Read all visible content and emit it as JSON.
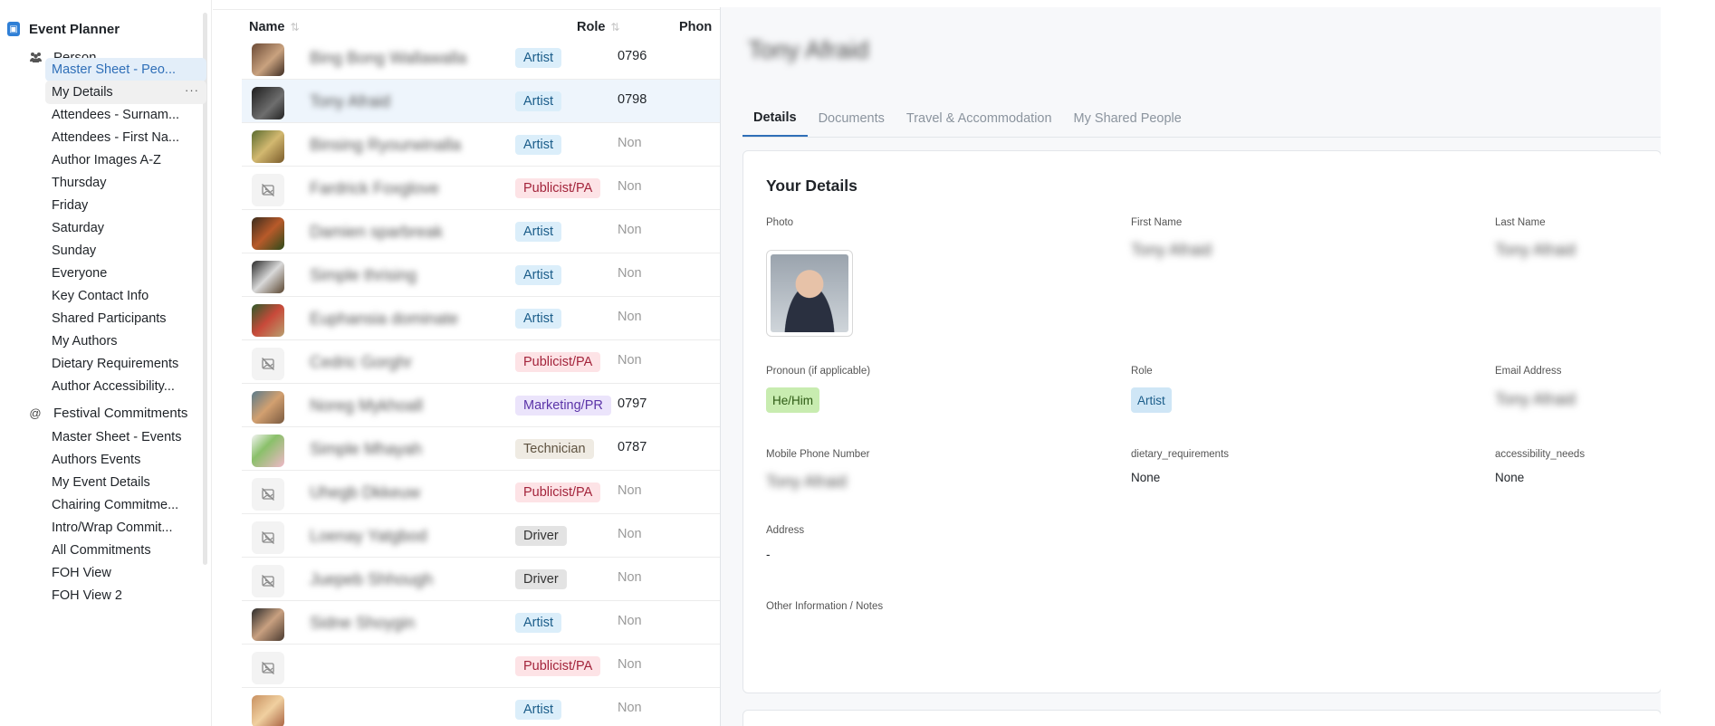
{
  "sidebar": {
    "app_title": "Event Planner",
    "sections": [
      {
        "label": "Person",
        "items": [
          {
            "label": "Master Sheet - Peo..."
          },
          {
            "label": "My Details"
          },
          {
            "label": "Attendees - Surnam..."
          },
          {
            "label": "Attendees - First Na..."
          },
          {
            "label": "Author Images A-Z"
          },
          {
            "label": "Thursday"
          },
          {
            "label": "Friday"
          },
          {
            "label": "Saturday"
          },
          {
            "label": "Sunday"
          },
          {
            "label": "Everyone"
          },
          {
            "label": "Key Contact Info"
          },
          {
            "label": "Shared Participants"
          },
          {
            "label": "My Authors"
          },
          {
            "label": "Dietary Requirements"
          },
          {
            "label": "Author Accessibility..."
          }
        ]
      },
      {
        "label": "Festival Commitments",
        "items": [
          {
            "label": "Master Sheet - Events"
          },
          {
            "label": "Authors Events"
          },
          {
            "label": "My Event Details"
          },
          {
            "label": "Chairing Commitme..."
          },
          {
            "label": "Intro/Wrap Commit..."
          },
          {
            "label": "All Commitments"
          },
          {
            "label": "FOH View"
          },
          {
            "label": "FOH View 2"
          }
        ]
      }
    ],
    "more_label": "···"
  },
  "table": {
    "columns": {
      "name": "Name",
      "role": "Role",
      "phone": "Phon"
    },
    "sort_glyph": "⇅",
    "rows": [
      {
        "name": "Bing Bong Wallawalla",
        "role": "Artist",
        "phone": "0796"
      },
      {
        "name": "Tony Afraid",
        "role": "Artist",
        "phone": "0798"
      },
      {
        "name": "Binsing Ryourwinalla",
        "role": "Artist",
        "phone": "Non"
      },
      {
        "name": "Fardrick Foxglove",
        "role": "Publicist/PA",
        "phone": "Non"
      },
      {
        "name": "Damien sparbreak",
        "role": "Artist",
        "phone": "Non"
      },
      {
        "name": "Simple thrising",
        "role": "Artist",
        "phone": "Non"
      },
      {
        "name": "Euphansia dominate",
        "role": "Artist",
        "phone": "Non"
      },
      {
        "name": "Cedric Gorghr",
        "role": "Publicist/PA",
        "phone": "Non"
      },
      {
        "name": "Noreg Mykhoall",
        "role": "Marketing/PR",
        "phone": "0797"
      },
      {
        "name": "Simple Mhayah",
        "role": "Technician",
        "phone": "0787"
      },
      {
        "name": "Uhegb Dkkeuw",
        "role": "Publicist/PA",
        "phone": "Non"
      },
      {
        "name": "Loenay Yatgbod",
        "role": "Driver",
        "phone": "Non"
      },
      {
        "name": "Juepeb Shhough",
        "role": "Driver",
        "phone": "Non"
      },
      {
        "name": "Sidne Shoygin",
        "role": "Artist",
        "phone": "Non"
      },
      {
        "name": "",
        "role": "Publicist/PA",
        "phone": "Non"
      },
      {
        "name": "",
        "role": "Artist",
        "phone": "Non"
      }
    ]
  },
  "role_colors": {
    "Artist": {
      "bg": "#dbeefa",
      "fg": "#1b5d8a"
    },
    "Publicist/PA": {
      "bg": "#fde3e6",
      "fg": "#a3243b"
    },
    "Marketing/PR": {
      "bg": "#ebe4fb",
      "fg": "#5b34a8"
    },
    "Technician": {
      "bg": "#efebe3",
      "fg": "#5f5341"
    },
    "Driver": {
      "bg": "#e3e3e3",
      "fg": "#333333"
    }
  },
  "panel": {
    "title": "Tony Afraid",
    "tabs": [
      "Details",
      "Documents",
      "Travel & Accommodation",
      "My Shared People"
    ],
    "card_title": "Your Details",
    "fields": {
      "photo_label": "Photo",
      "first_name_label": "First Name",
      "first_name_value": "Tony Afraid",
      "last_name_label": "Last Name",
      "last_name_value": "Tony Afraid",
      "pronoun_label": "Pronoun (if applicable)",
      "pronoun_value": "He/Him",
      "role_label": "Role",
      "role_value": "Artist",
      "email_label": "Email Address",
      "email_value": "Tony Afraid",
      "mobile_label": "Mobile Phone Number",
      "mobile_value": "Tony Afraid",
      "dietary_label": "dietary_requirements",
      "dietary_value": "None",
      "accessibility_label": "accessibility_needs",
      "accessibility_value": "None",
      "address_label": "Address",
      "address_value": "-",
      "notes_label": "Other Information / Notes"
    }
  },
  "colors": {
    "accent": "#2f6fb8",
    "active_nav_bg": "#e3eef9",
    "selected_row_bg": "#eef5fc",
    "pronoun_chip_bg": "#c8ecb0",
    "role_chip_bg": "#cfe6f6"
  }
}
